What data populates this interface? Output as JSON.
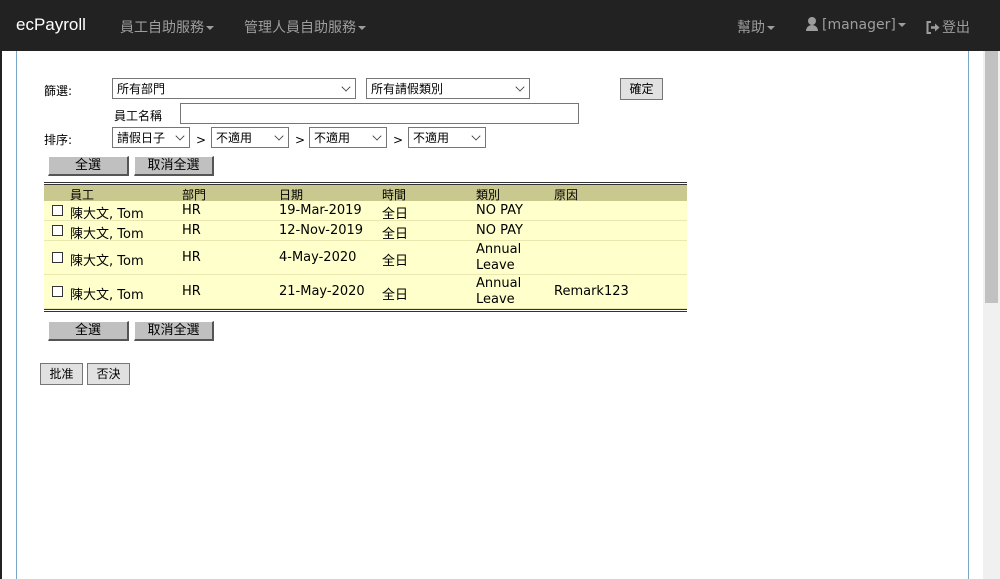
{
  "nav": {
    "brand": "ecPayroll",
    "employee_menu": "員工自助服務",
    "manager_menu": "管理人員自助服務",
    "help": "幫助",
    "user": "[manager]",
    "logout": "登出"
  },
  "filter": {
    "label": "篩選:",
    "department": "所有部門",
    "leave_type": "所有請假類別",
    "confirm": "確定",
    "employee_name_label": "員工名稱",
    "employee_name_value": ""
  },
  "sort": {
    "label": "排序:",
    "sort1": "請假日子",
    "sort2": "不適用",
    "sort3": "不適用",
    "sort4": "不適用",
    "separator": ">"
  },
  "actions": {
    "select_all": "全選",
    "deselect_all": "取消全選",
    "approve": "批准",
    "reject": "否決"
  },
  "table": {
    "headers": [
      "員工",
      "部門",
      "日期",
      "時間",
      "類別",
      "原因"
    ],
    "rows": [
      {
        "employee": "陳大文, Tom",
        "dept": "HR",
        "date": "19-Mar-2019",
        "time": "全日",
        "type1": "NO PAY",
        "type2": "",
        "reason": ""
      },
      {
        "employee": "陳大文, Tom",
        "dept": "HR",
        "date": "12-Nov-2019",
        "time": "全日",
        "type1": "NO PAY",
        "type2": "",
        "reason": ""
      },
      {
        "employee": "陳大文, Tom",
        "dept": "HR",
        "date": "4-May-2020",
        "time": "全日",
        "type1": "Annual",
        "type2": "Leave",
        "reason": ""
      },
      {
        "employee": "陳大文, Tom",
        "dept": "HR",
        "date": "21-May-2020",
        "time": "全日",
        "type1": "Annual",
        "type2": "Leave",
        "reason": "Remark123"
      }
    ]
  },
  "colors": {
    "navbar": "#222222",
    "header_row": "#c9c88e",
    "data_row": "#ffffcc"
  }
}
